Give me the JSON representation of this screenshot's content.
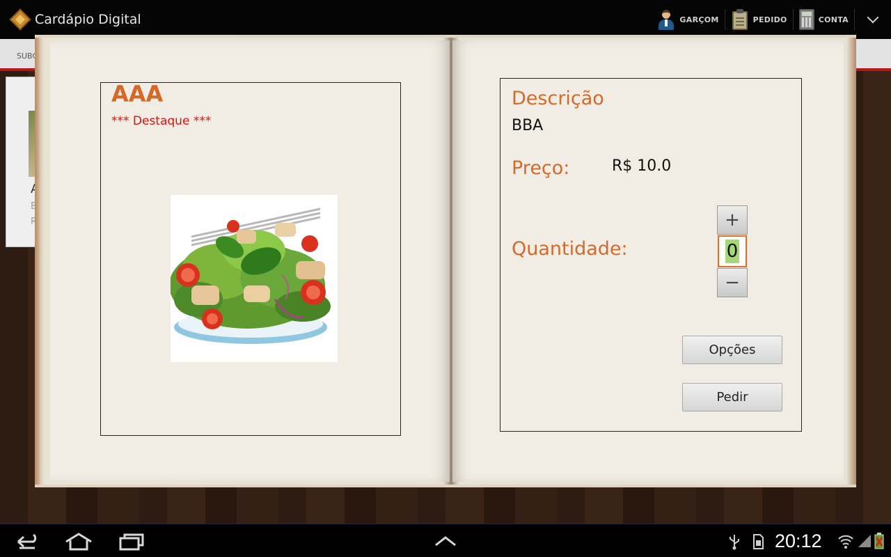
{
  "app": {
    "title": "Cardápio Digital",
    "accent": "#d46a2a"
  },
  "actionbar": {
    "waiter_label": "GARÇOM",
    "order_label": "PEDIDO",
    "bill_label": "CONTA",
    "icons": [
      "app-logo-icon",
      "waiter-icon",
      "order-pad-icon",
      "calculator-icon",
      "chevron-down-icon"
    ]
  },
  "background": {
    "tab_label": "SUBC",
    "card_title": "A",
    "card_line1": "B",
    "card_line2": "R"
  },
  "dish": {
    "name": "AAA",
    "tag": "*** Destaque ***",
    "description_label": "Descrição",
    "description": "BBA",
    "price_label": "Preço:",
    "price": "R$ 10.0",
    "quantity_label": "Quantidade:",
    "quantity": "0",
    "photo": "salad-photo"
  },
  "buttons": {
    "options": "Opções",
    "order": "Pedir",
    "plus": "+",
    "minus": "−"
  },
  "system": {
    "clock": "20:12",
    "icons": [
      "back-icon",
      "home-icon",
      "recent-apps-icon",
      "up-arrow-icon",
      "usb-icon",
      "sd-card-icon",
      "wifi-icon",
      "signal-icon",
      "battery-icon"
    ]
  }
}
